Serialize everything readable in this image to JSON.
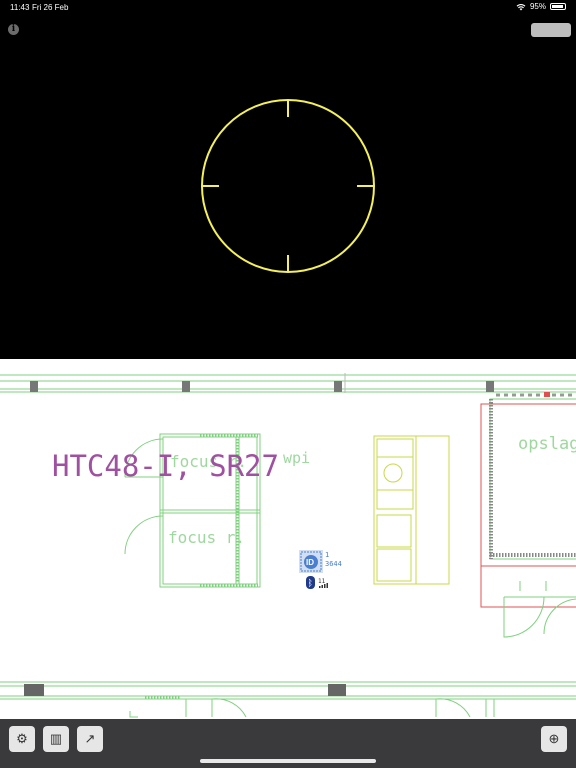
{
  "status_bar": {
    "time": "11:43",
    "date": "Fri 26 Feb",
    "battery": "95%"
  },
  "icons": {
    "info": "i",
    "settings": "⚙",
    "map": "▥",
    "export": "↗",
    "locate": "⊕"
  },
  "floorplan": {
    "building_label": "HTC48-I, SR27",
    "room_focus_1": "focus r.",
    "room_focus_2": "focus r.",
    "room_wpi": "wpi",
    "room_opslag": "opslag",
    "beacon_id": "ID",
    "beacon_number_1": "1",
    "beacon_number_2": "3644",
    "beacon_signal": "11"
  },
  "colors": {
    "crosshair": "#f4f05a",
    "label_purple": "#a050a0",
    "wall_green": "#7fd07f",
    "wall_red": "#e05050",
    "toolbar": "#3a3a3c",
    "beacon_blue": "#4a7fd0"
  }
}
